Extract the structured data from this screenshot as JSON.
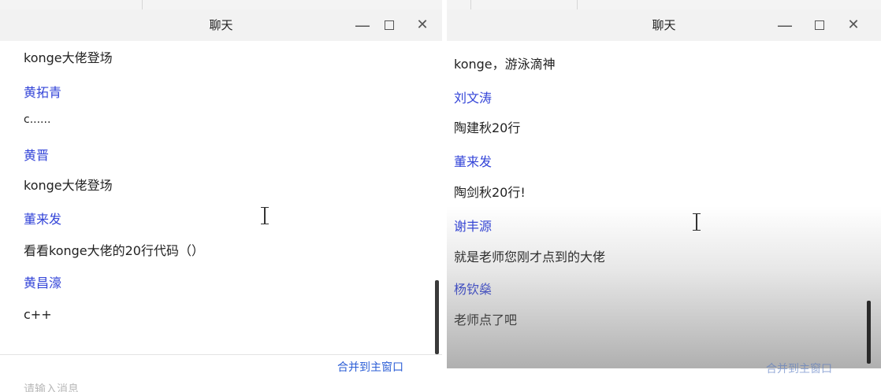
{
  "left_window": {
    "title": "聊天",
    "controls": {
      "minimize": "—",
      "maximize": "",
      "close": "✕"
    },
    "messages": [
      {
        "kind": "text",
        "text": "konge大佬登场"
      },
      {
        "kind": "name",
        "text": "黄拓青"
      },
      {
        "kind": "text",
        "text": "c......"
      },
      {
        "kind": "name",
        "text": "黄晋"
      },
      {
        "kind": "text",
        "text": "konge大佬登场"
      },
      {
        "kind": "name",
        "text": "董来发"
      },
      {
        "kind": "text",
        "text": "看看konge大佬的20行代码（）"
      },
      {
        "kind": "name",
        "text": "黄昌濠"
      },
      {
        "kind": "text",
        "text": "c++"
      }
    ],
    "merge_label": "合并到主窗口",
    "input_placeholder": "请输入消息"
  },
  "right_window": {
    "title": "聊天",
    "controls": {
      "minimize": "—",
      "maximize": "",
      "close": "✕"
    },
    "messages": [
      {
        "kind": "text",
        "text": "konge，游泳滴神"
      },
      {
        "kind": "name",
        "text": "刘文涛"
      },
      {
        "kind": "text",
        "text": "陶建秋20行"
      },
      {
        "kind": "name",
        "text": "董来发"
      },
      {
        "kind": "text",
        "text": "陶剑秋20行!"
      },
      {
        "kind": "name",
        "text": "谢丰源"
      },
      {
        "kind": "text",
        "text": "就是老师您刚才点到的大佬"
      },
      {
        "kind": "name",
        "text": "杨钦燊"
      },
      {
        "kind": "text",
        "text": "老师点了吧"
      }
    ],
    "merge_label": "合并到主窗口"
  },
  "colors": {
    "name_blue": "#3344d8",
    "link_blue": "#2d5fd6",
    "titlebar_bg": "#f2f2f2"
  }
}
